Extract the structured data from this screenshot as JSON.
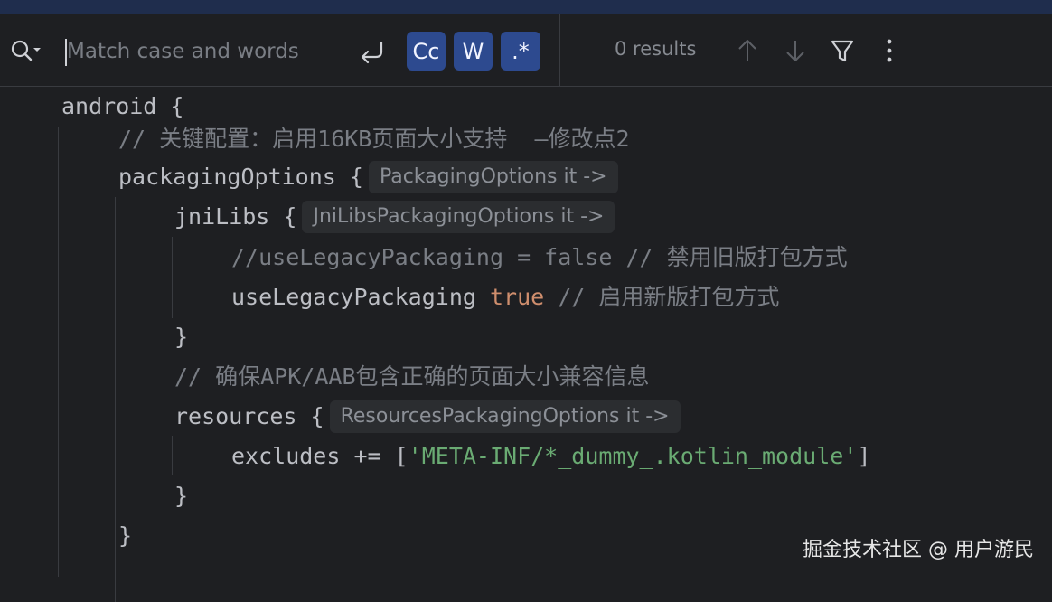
{
  "search": {
    "placeholder": "Match case and words",
    "value": "",
    "results": "0 results"
  },
  "toggles": {
    "match_case": "Cc",
    "words": "W",
    "regex": ".*"
  },
  "colors": {
    "toggle_active": "#2d4a8f",
    "keyword": "#cf8e6d",
    "string": "#6aab73",
    "comment": "#7a7e85"
  },
  "code": {
    "sticky": "android {",
    "l1": "// 关键配置：启用16KB页面大小支持  —修改点2",
    "l2": "packagingOptions {",
    "l2_hint": "PackagingOptions it ->",
    "l3": "jniLibs {",
    "l3_hint": "JniLibsPackagingOptions it ->",
    "l4": "//useLegacyPackaging = false // 禁用旧版打包方式",
    "l5_prop": "useLegacyPackaging ",
    "l5_value": "true",
    "l5_comment": " // 启用新版打包方式",
    "l6": "}",
    "l7": "// 确保APK/AAB包含正确的页面大小兼容信息",
    "l8": "resources {",
    "l8_hint": "ResourcesPackagingOptions it ->",
    "l9_prefix": "excludes += [",
    "l9_string": "'META-INF/*_dummy_.kotlin_module'",
    "l9_suffix": "]",
    "l10": "}",
    "l11": "}"
  },
  "watermark": "掘金技术社区 @ 用户游民"
}
